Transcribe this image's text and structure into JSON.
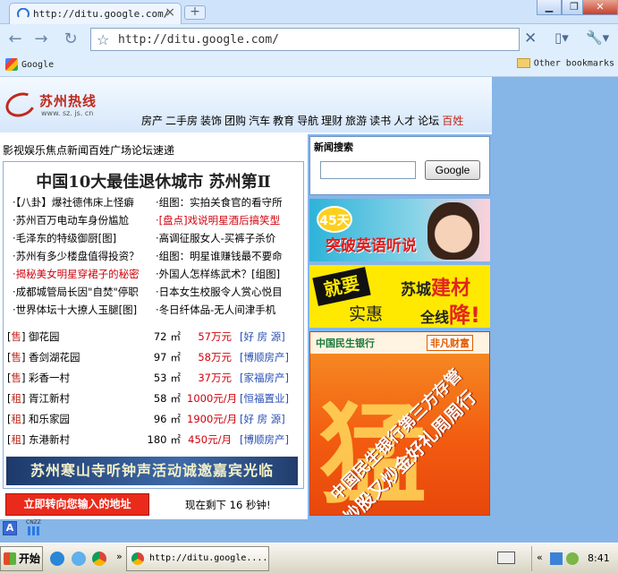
{
  "browser": {
    "tab_title": "http://ditu.google.com/",
    "url": "http://ditu.google.com/",
    "new_tab_symbol": "+",
    "window_controls": [
      "_",
      "□",
      "X"
    ],
    "bookmarks": {
      "left": "Google",
      "right": "Other bookmarks"
    }
  },
  "site": {
    "logo_name": "苏州热线",
    "logo_domain": "www. sz. js. cn",
    "top_nav": [
      "房产",
      "二手房",
      "装饰",
      "团购",
      "汽车",
      "教育",
      "导航",
      "理财",
      "旅游",
      "读书",
      "人才",
      "论坛"
    ],
    "top_nav_highlight": "百姓",
    "sub_nav": "影视娱乐焦点新闻百姓广场论坛速递",
    "headline": "中国10大最佳退休城市 苏州第Ⅱ",
    "news": [
      {
        "left": "·【八卦】爆社德伟床上怪癖",
        "left_red": false,
        "right": "·组图：实拍关食官的看守所",
        "right_red": false
      },
      {
        "left": "·苏州百万电动车身份尴尬",
        "left_red": false,
        "right": "·[盘点]戏说明星酒后搞笑型",
        "right_red": true
      },
      {
        "left": "·毛泽东的特级御厨[图]",
        "left_red": false,
        "right": "·高调征服女人-买裤子杀价",
        "right_red": false
      },
      {
        "left": "·苏州有多少楼盘值得投资？",
        "left_red": false,
        "right": "·组图：明星谁赚钱最不要命",
        "right_red": false
      },
      {
        "left": "·揭秘美女明星穿裙子的秘密",
        "left_red": true,
        "right": "·外国人怎样练武术？[组图]",
        "right_red": false
      },
      {
        "left": "·成都城管局长因\"自焚\"停职",
        "left_red": false,
        "right": "·日本女生校服令人赏心悦目",
        "right_red": false
      },
      {
        "left": "·世界体坛十大撩人玉腿[图]",
        "left_red": false,
        "right": "·冬日纤体品-无人间津手机",
        "right_red": false
      }
    ],
    "listings": [
      {
        "tag": "售",
        "name": "御花园",
        "area": "72",
        "unit": "㎡",
        "price": "57万元",
        "agent": "[好 房 源]"
      },
      {
        "tag": "售",
        "name": "香剑湖花园",
        "area": "97",
        "unit": "㎡",
        "price": "58万元",
        "agent": "[博顺房产]"
      },
      {
        "tag": "售",
        "name": "彩香一村",
        "area": "53",
        "unit": "㎡",
        "price": "37万元",
        "agent": "[家福房产]"
      },
      {
        "tag": "租",
        "name": "胥江新村",
        "area": "58",
        "unit": "㎡",
        "price": "1000元/月",
        "agent": "[恒福置业]"
      },
      {
        "tag": "租",
        "name": "和乐家园",
        "area": "96",
        "unit": "㎡",
        "price": "1900元/月",
        "agent": "[好 房 源]"
      },
      {
        "tag": "租",
        "name": "东港新村",
        "area": "180",
        "unit": "㎡",
        "price": "450元/月",
        "agent": "[博顺房产]"
      }
    ],
    "promo_banner": "苏州寒山寺听钟声活动诚邀嘉宾光临",
    "search_title": "新闻搜索",
    "search_button": "Google",
    "ad_english": {
      "number": "45天",
      "text": "突破英语听说"
    },
    "ad_promo": {
      "quote": "就要",
      "sub": "实惠",
      "line1_a": "苏城",
      "line1_b": "建材",
      "line2_a": "全线",
      "line2_b": "降!"
    },
    "ad_bank": {
      "bank": "中国民生银行",
      "brand": "非凡财富",
      "big": "猛",
      "line1": "中国民生银行第三方存管",
      "line2": "炒股又炒金好礼周周行"
    },
    "redirect_button": "立即转向您输入的地址",
    "countdown": "现在剩下 16 秒钟!",
    "icon_a": "A",
    "icon_cnzz": "CNZZ"
  },
  "taskbar": {
    "start": "开始",
    "task": "http://ditu.google....",
    "more": "»",
    "tray_chevron": "«",
    "clock": "8:41"
  },
  "colors": {
    "accent": "#c0281c",
    "page_bg": "#86b5e8",
    "agent_link": "#2a4fb4"
  }
}
